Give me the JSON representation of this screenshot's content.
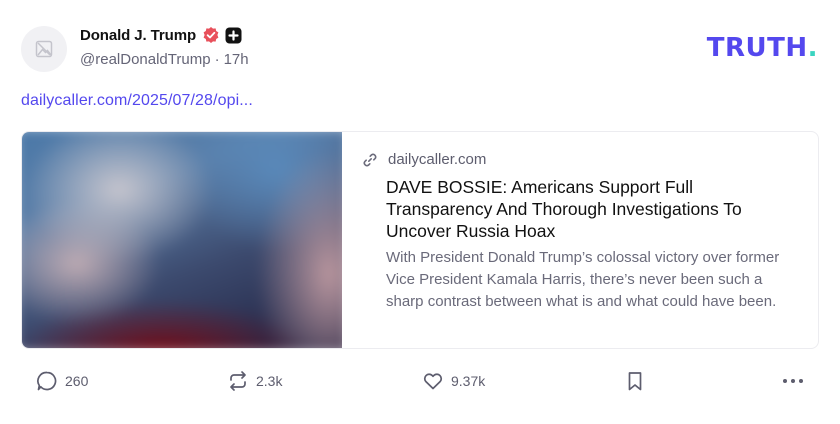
{
  "header": {
    "display_name": "Donald J. Trump",
    "handle": "@realDonaldTrump",
    "separator": "·",
    "time_ago": "17h",
    "brand_main": "TRUTH",
    "brand_dot": "."
  },
  "post": {
    "link_text": "dailycaller.com/2025/07/28/opi..."
  },
  "card": {
    "domain": "dailycaller.com",
    "title": "DAVE BOSSIE: Americans Support Full Transparency And Thorough Investigations To Uncover Russia Hoax",
    "description": "With President Donald Trump’s colossal victory over former Vice President Kamala Harris, there’s never been such a sharp contrast between what is and what could have been."
  },
  "actions": {
    "replies": "260",
    "retruths": "2.3k",
    "likes": "9.37k"
  },
  "icons": [
    "image-placeholder-icon",
    "verified-icon",
    "plus-badge-icon",
    "link-icon",
    "reply-icon",
    "retruth-icon",
    "heart-icon",
    "bookmark-icon",
    "more-icon"
  ],
  "colors": {
    "brand": "#5448ee",
    "brand_dot": "#3ad4c0",
    "verified": "#e8505b",
    "link": "#5448ee"
  }
}
